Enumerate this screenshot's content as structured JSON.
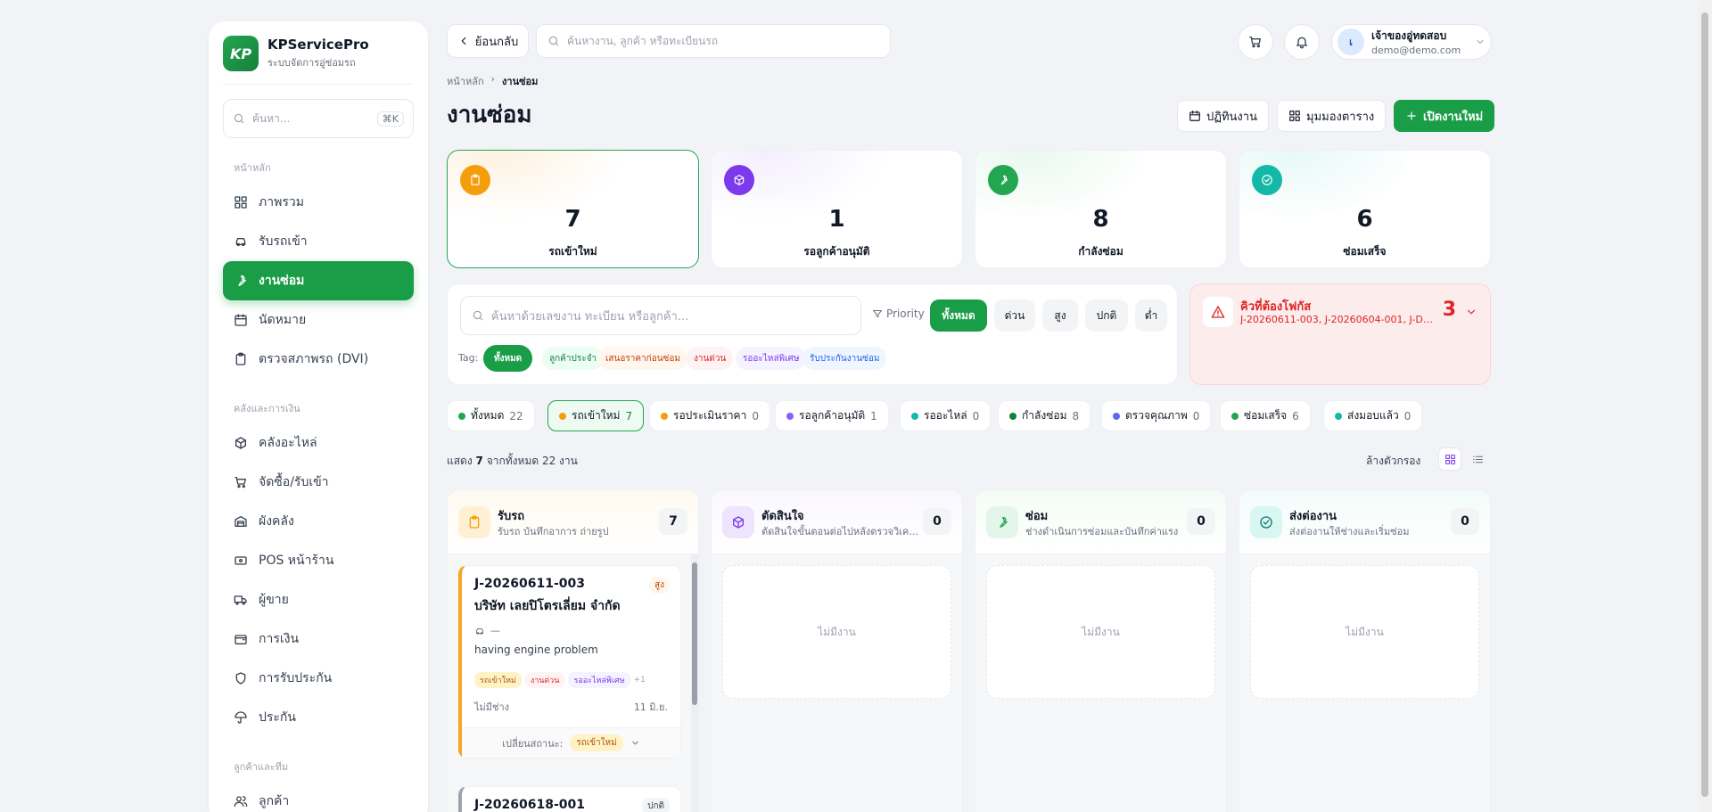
{
  "sidebar": {
    "brand_logo": "KP",
    "brand_name": "KPServicePro",
    "brand_sub": "ระบบจัดการอู่ซ่อมรถ",
    "search_placeholder": "ค้นหา...",
    "search_shortcut": "⌘K",
    "sections": [
      {
        "title": "หน้าหลัก",
        "items": [
          {
            "label": "ภาพรวม",
            "icon": "grid-icon"
          },
          {
            "label": "รับรถเข้า",
            "icon": "car-icon"
          },
          {
            "label": "งานซ่อม",
            "icon": "wrench-icon",
            "active": true
          },
          {
            "label": "นัดหมาย",
            "icon": "calendar-icon"
          },
          {
            "label": "ตรวจสภาพรถ (DVI)",
            "icon": "clipboard-icon"
          }
        ]
      },
      {
        "title": "คลังและการเงิน",
        "items": [
          {
            "label": "คลังอะไหล่",
            "icon": "box-icon"
          },
          {
            "label": "จัดซื้อ/รับเข้า",
            "icon": "cart-icon"
          },
          {
            "label": "ผังคลัง",
            "icon": "warehouse-icon"
          },
          {
            "label": "POS หน้าร้าน",
            "icon": "pos-icon"
          },
          {
            "label": "ผู้ขาย",
            "icon": "truck-icon"
          },
          {
            "label": "การเงิน",
            "icon": "wallet-icon"
          },
          {
            "label": "การรับประกัน",
            "icon": "shield-icon"
          },
          {
            "label": "ประกัน",
            "icon": "umbrella-icon"
          }
        ]
      },
      {
        "title": "ลูกค้าและทีม",
        "items": [
          {
            "label": "ลูกค้า",
            "icon": "users-icon"
          }
        ]
      }
    ]
  },
  "topbar": {
    "back_label": "ย้อนกลับ",
    "search_placeholder": "ค้นหางาน, ลูกค้า หรือทะเบียนรถ",
    "user_initial": "เ",
    "user_name": "เจ้าของอู่ทดสอบ",
    "user_email": "demo@demo.com"
  },
  "breadcrumb": {
    "home": "หน้าหลัก",
    "sep": "›",
    "current": "งานซ่อม"
  },
  "page_title": "งานซ่อม",
  "actions": {
    "calendar": "ปฏิทินงาน",
    "table": "มุมมองตาราง",
    "new": "เปิดงานใหม่"
  },
  "stats": [
    {
      "value": "7",
      "label": "รถเข้าใหม่",
      "color": "#f59e0b",
      "icon": "clipboard-icon",
      "selected": true
    },
    {
      "value": "1",
      "label": "รอลูกค้าอนุมัติ",
      "color": "#7c3aed",
      "icon": "box-icon"
    },
    {
      "value": "8",
      "label": "กำลังซ่อม",
      "color": "#22a650",
      "icon": "wrench-icon"
    },
    {
      "value": "6",
      "label": "ซ่อมเสร็จ",
      "color": "#14b8a6",
      "icon": "check-circle-icon"
    }
  ],
  "filter": {
    "search_placeholder": "ค้นหาด้วยเลขงาน ทะเบียน หรือลูกค้า...",
    "priority_label": "Priority",
    "priorities": [
      "ทั้งหมด",
      "ด่วน",
      "สูง",
      "ปกติ",
      "ต่ำ"
    ],
    "tag_label": "Tag:",
    "tags": [
      {
        "label": "ทั้งหมด",
        "bg": "#1a9d47",
        "fg": "#ffffff"
      },
      {
        "label": "ลูกค้าประจำ",
        "bg": "#ecfdf3",
        "fg": "#15803d"
      },
      {
        "label": "เสนอราคาก่อนซ่อม",
        "bg": "#fff7ed",
        "fg": "#c2410c"
      },
      {
        "label": "งานด่วน",
        "bg": "#fef2f2",
        "fg": "#dc2626"
      },
      {
        "label": "รออะไหล่พิเศษ",
        "bg": "#f5f3ff",
        "fg": "#7c3aed"
      },
      {
        "label": "รับประกันงานซ่อม",
        "bg": "#eff6ff",
        "fg": "#2563eb"
      }
    ]
  },
  "focus": {
    "title": "คิวที่ต้องโฟกัส",
    "jobs": "J-20260611-003, J-20260604-001, J-DE...",
    "count": "3"
  },
  "status_chips": [
    {
      "label": "ทั้งหมด",
      "count": "22",
      "color": "#22a650"
    },
    {
      "label": "รถเข้าใหม่",
      "count": "7",
      "color": "#f59e0b",
      "selected": true
    },
    {
      "label": "รอประเมินราคา",
      "count": "0",
      "color": "#f59e0b"
    },
    {
      "label": "รอลูกค้าอนุมัติ",
      "count": "1",
      "color": "#8b5cf6"
    },
    {
      "label": "รออะไหล่",
      "count": "0",
      "color": "#14b8a6"
    },
    {
      "label": "กำลังซ่อม",
      "count": "8",
      "color": "#15803d"
    },
    {
      "label": "ตรวจคุณภาพ",
      "count": "0",
      "color": "#6366f1"
    },
    {
      "label": "ซ่อมเสร็จ",
      "count": "6",
      "color": "#22a650"
    },
    {
      "label": "ส่งมอบแล้ว",
      "count": "0",
      "color": "#14b8a6"
    }
  ],
  "summary": {
    "prefix": "แสดง",
    "shown": "7",
    "suffix": "จากทั้งหมด 22 งาน",
    "clear": "ล้างตัวกรอง"
  },
  "columns": [
    {
      "title": "รับรถ",
      "subtitle": "รับรถ บันทึกอาการ ถ่ายรูป",
      "count": "7",
      "color": "#f59e0b",
      "bg": "#fff7e6",
      "icon": "clipboard-icon"
    },
    {
      "title": "ตัดสินใจ",
      "subtitle": "ตัดสินใจขั้นตอนต่อไปหลังตรวจวิเคราะห์",
      "count": "0",
      "color": "#7c3aed",
      "bg": "#f1ecfe",
      "icon": "box-icon",
      "empty": "ไม่มีงาน"
    },
    {
      "title": "ซ่อม",
      "subtitle": "ช่างดำเนินการซ่อมและบันทึกค่าแรง",
      "count": "0",
      "color": "#22a650",
      "bg": "#e9f8ee",
      "icon": "wrench-icon",
      "empty": "ไม่มีงาน"
    },
    {
      "title": "ส่งต่องาน",
      "subtitle": "ส่งต่องานให้ช่างและเริ่มซ่อม",
      "count": "0",
      "color": "#14b8a6",
      "bg": "#e6f8f5",
      "icon": "check-circle-icon",
      "empty": "ไม่มีงาน"
    }
  ],
  "cards": [
    {
      "id": "J-20260611-003",
      "priority": "สูง",
      "name": "บริษัท เลยปิโตรเลี่ยม จำกัด",
      "plate": "—",
      "desc": "having engine problem",
      "tags": [
        {
          "label": "รถเข้าใหม่",
          "bg": "#fef3c7",
          "fg": "#b45309"
        },
        {
          "label": "งานด่วน",
          "bg": "#fef2f2",
          "fg": "#dc2626"
        },
        {
          "label": "รออะไหล่พิเศษ",
          "bg": "#f5f3ff",
          "fg": "#7c3aed"
        }
      ],
      "more": "+1",
      "tech": "ไม่มีช่าง",
      "date": "11 มิ.ย.",
      "status_label": "เปลี่ยนสถานะ:",
      "status_value": "รถเข้าใหม่"
    },
    {
      "id": "J-20260618-001",
      "priority": "ปกติ"
    }
  ]
}
